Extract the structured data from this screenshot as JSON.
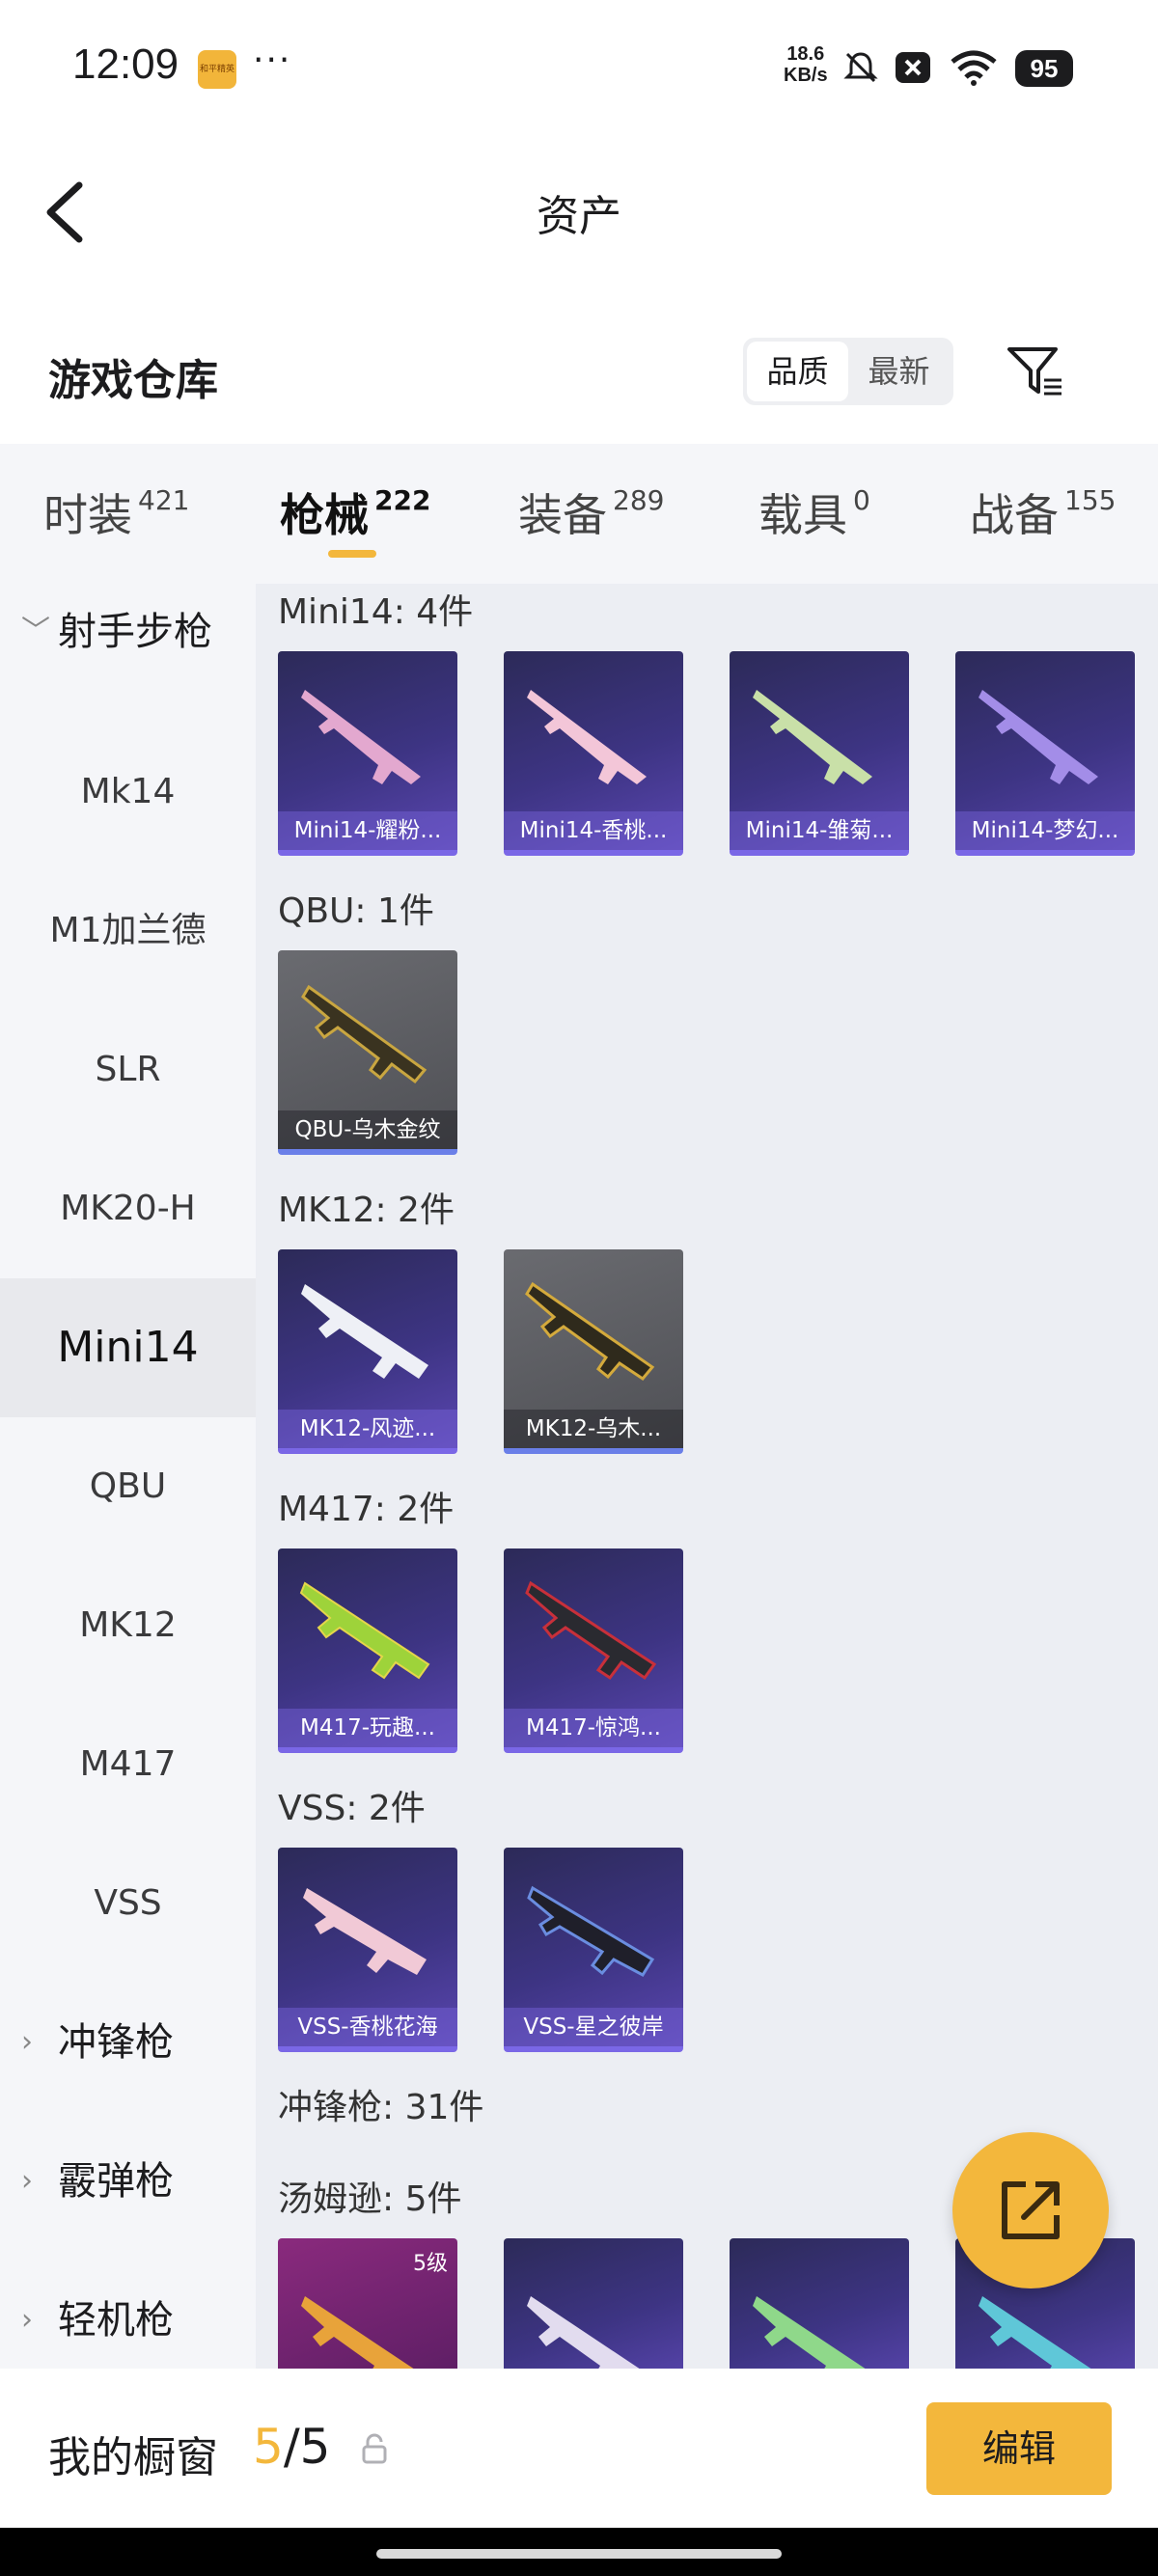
{
  "status_bar": {
    "time": "12:09",
    "more": "···",
    "net_speed": "18.6",
    "net_unit": "KB/s",
    "battery": "95",
    "app_icon_text": "和平精英"
  },
  "header": {
    "title": "资产"
  },
  "warehouse": {
    "title": "游戏仓库",
    "sort_options": [
      "品质",
      "最新"
    ]
  },
  "tabs": [
    {
      "label": "时装",
      "count": "421"
    },
    {
      "label": "枪械",
      "count": "222"
    },
    {
      "label": "装备",
      "count": "289"
    },
    {
      "label": "载具",
      "count": "0"
    },
    {
      "label": "战备",
      "count": "155"
    }
  ],
  "sidebar": {
    "group_expanded": "射手步枪",
    "items": [
      "Mk14",
      "M1加兰德",
      "SLR",
      "MK20-H",
      "Mini14",
      "QBU",
      "MK12",
      "M417",
      "VSS"
    ],
    "groups_collapsed": [
      "冲锋枪",
      "霰弹枪",
      "轻机枪"
    ]
  },
  "sections": [
    {
      "title": "Mini14: 4件",
      "items": [
        "Mini14-耀粉...",
        "Mini14-香桃...",
        "Mini14-雏菊...",
        "Mini14-梦幻..."
      ]
    },
    {
      "title": "QBU: 1件",
      "items": [
        "QBU-乌木金纹"
      ]
    },
    {
      "title": "MK12: 2件",
      "items": [
        "MK12-风迹...",
        "MK12-乌木..."
      ]
    },
    {
      "title": "M417: 2件",
      "items": [
        "M417-玩趣...",
        "M417-惊鸿..."
      ]
    },
    {
      "title": "VSS: 2件",
      "items": [
        "VSS-香桃花海",
        "VSS-星之彼岸"
      ]
    },
    {
      "title": "冲锋枪: 31件",
      "items": []
    },
    {
      "title": "汤姆逊: 5件",
      "items": [],
      "first_level": "5级"
    }
  ],
  "bottom_bar": {
    "label": "我的橱窗",
    "current": "5",
    "separator": "/",
    "total": "5",
    "edit_label": "编辑"
  },
  "colors": {
    "accent": "#f3b73c",
    "card_purple": "#3d3483",
    "card_gray": "#5a5b60",
    "sidebar_bg": "#f5f6f9",
    "content_bg": "#eceef3"
  }
}
